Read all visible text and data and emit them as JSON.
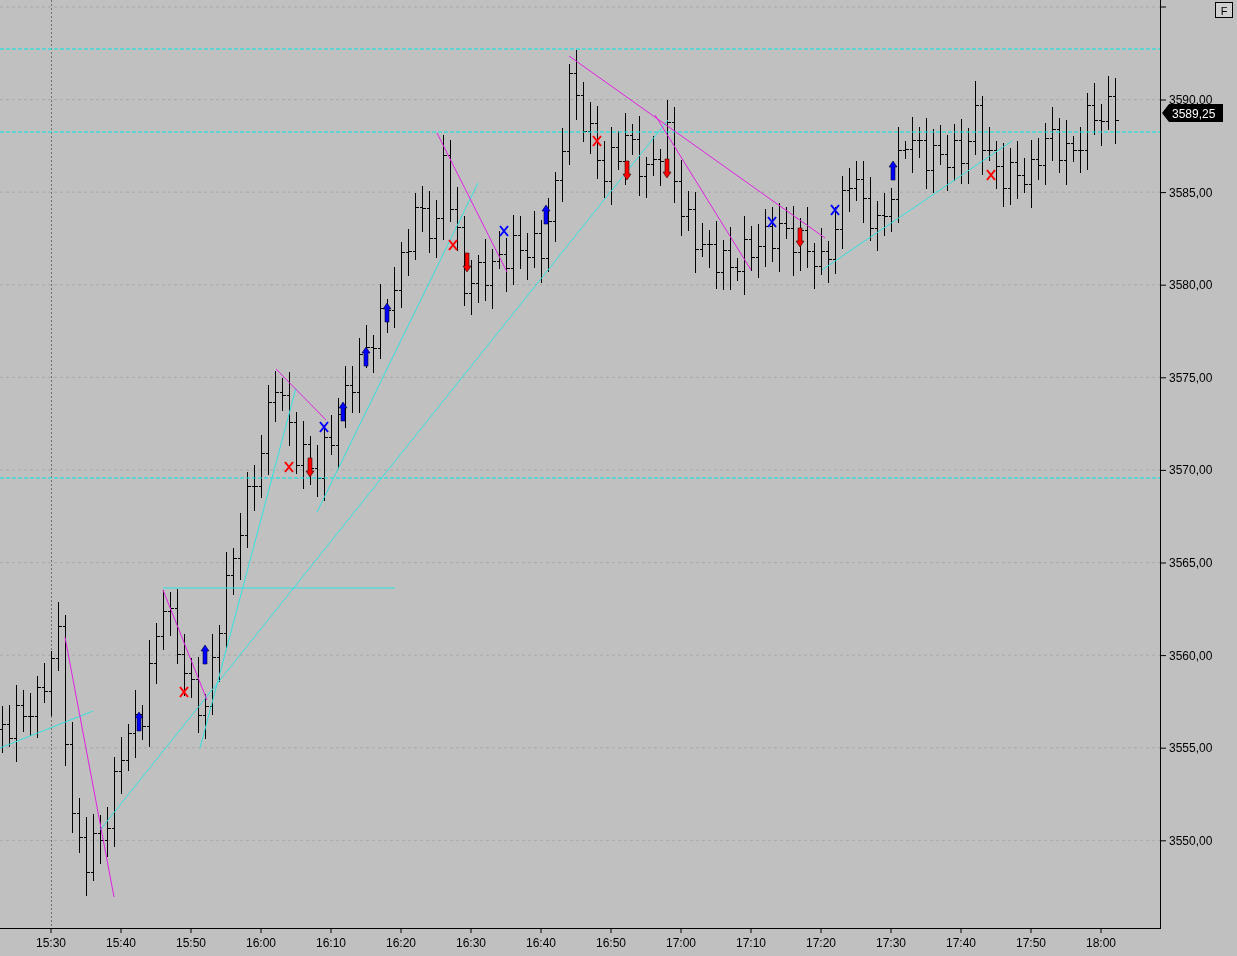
{
  "chart": {
    "corner_button": "F",
    "last_price": "3589,25",
    "price_labels": [
      "3590,00",
      "3585,00",
      "3580,00",
      "3575,00",
      "3570,00",
      "3565,00",
      "3560,00",
      "3555,00",
      "3550,00"
    ],
    "time_labels": [
      "15:30",
      "15:40",
      "15:50",
      "16:00",
      "16:10",
      "16:20",
      "16:30",
      "16:40",
      "16:50",
      "17:00",
      "17:10",
      "17:20",
      "17:30",
      "17:40",
      "17:50",
      "18:00"
    ]
  }
}
